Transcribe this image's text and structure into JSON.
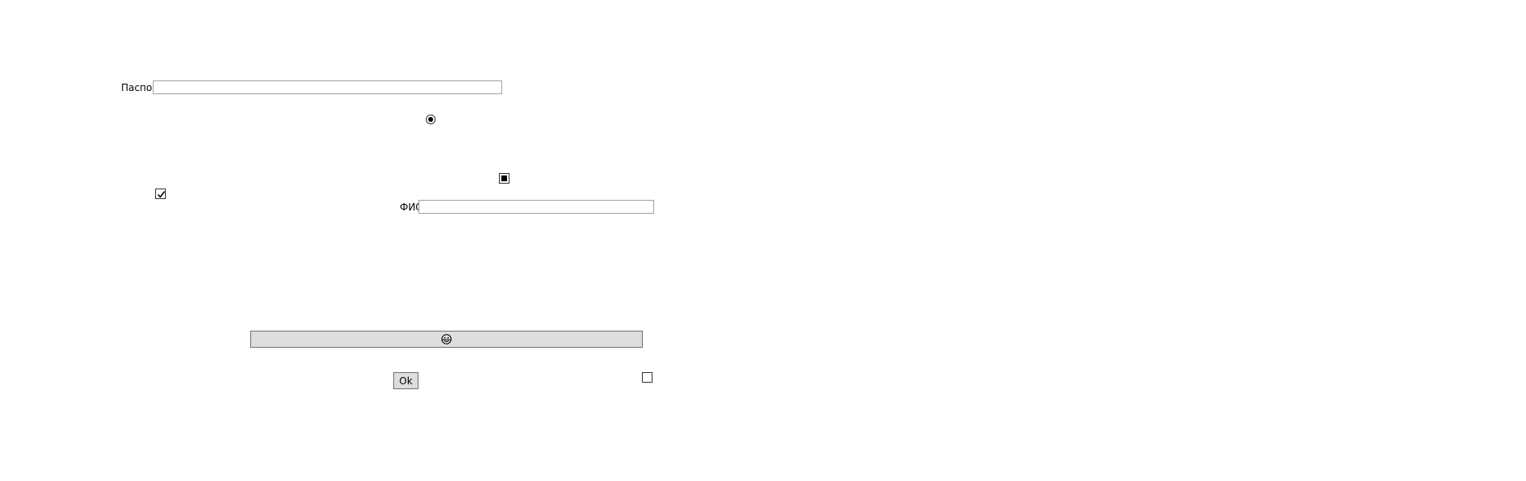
{
  "form": {
    "passport_label": "Паспорт",
    "passport_value": "",
    "fio_label": "ФИО",
    "fio_value": "",
    "ok_label": "Ok",
    "icon_button_icon": "emoji-face-icon",
    "radio_checked": true,
    "checkbox_left_checked": true,
    "checkbox_middle_state": "indeterminate",
    "checkbox_bottom_checked": false
  },
  "colors": {
    "button_bg": "#dddddd",
    "button_border": "#707070",
    "input_border": "#a0a0a0"
  }
}
